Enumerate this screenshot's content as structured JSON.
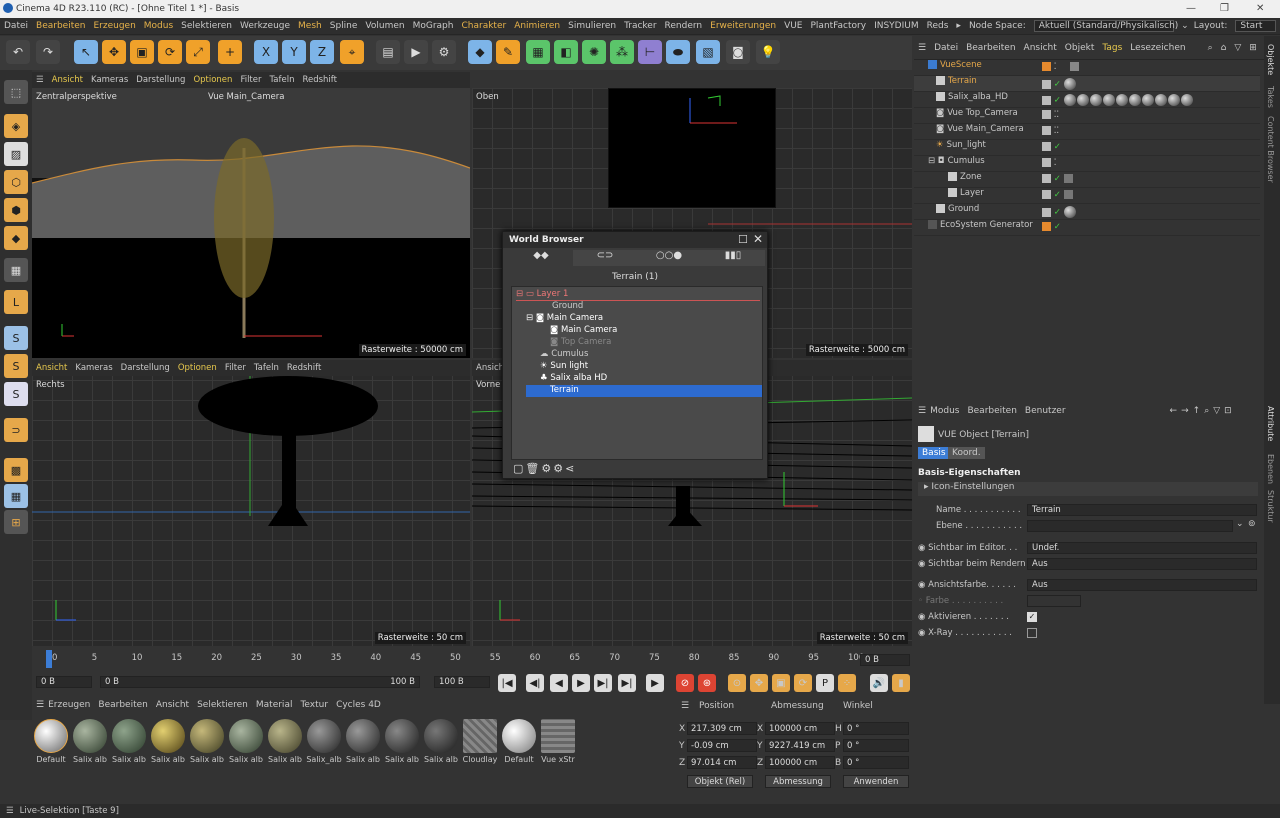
{
  "title": "Cinema 4D R23.110 (RC) - [Ohne Titel 1 *] - Basis",
  "menu": [
    "Datei",
    "Bearbeiten",
    "Erzeugen",
    "Modus",
    "Selektieren",
    "Werkzeuge",
    "Mesh",
    "Spline",
    "Volumen",
    "MoGraph",
    "Charakter",
    "Animieren",
    "Simulieren",
    "Tracker",
    "Rendern",
    "Erweiterungen",
    "VUE",
    "PlantFactory",
    "INSYDIUM",
    "Reds"
  ],
  "nodespace": {
    "label": "Node Space:",
    "value": "Aktuell (Standard/Physikalisch)"
  },
  "layout": {
    "label": "Layout:",
    "value": "Start"
  },
  "vp_menu": [
    "Ansicht",
    "Kameras",
    "Darstellung",
    "Optionen",
    "Filter",
    "Tafeln",
    "Redshift"
  ],
  "vp1": {
    "name": "Zentralperspektive",
    "camera": "Vue Main_Camera",
    "raster": "Rasterweite : 50000 cm"
  },
  "vp2": {
    "name": "Oben",
    "raster": "Rasterweite : 5000 cm"
  },
  "vp3": {
    "name": "Rechts",
    "raster": "Rasterweite : 50 cm"
  },
  "vp4": {
    "name": "Vorne",
    "raster": "Rasterweite : 50 cm",
    "menu_first": "Ansich"
  },
  "world_browser": {
    "title": "World Browser",
    "header": "Terrain (1)",
    "items": [
      "Layer 1",
      "Ground",
      "Main Camera",
      "Main Camera",
      "Top Camera",
      "Cumulus",
      "Sun light",
      "Salix alba HD",
      "Terrain"
    ]
  },
  "obj_menu": [
    "Datei",
    "Bearbeiten",
    "Ansicht",
    "Objekt",
    "Tags",
    "Lesezeichen"
  ],
  "objects": [
    "VueScene",
    "Terrain",
    "Salix_alba_HD",
    "Vue Top_Camera",
    "Vue Main_Camera",
    "Sun_light",
    "Cumulus",
    "Zone",
    "Layer",
    "Ground",
    "EcoSystem Generator"
  ],
  "attr": {
    "menu": [
      "Modus",
      "Bearbeiten",
      "Benutzer"
    ],
    "object": "VUE Object [Terrain]",
    "tabs": [
      "Basis",
      "Koord."
    ],
    "section": "Basis-Eigenschaften",
    "sub": "Icon-Einstellungen",
    "name_label": "Name . . . . . . . . . . .",
    "name_value": "Terrain",
    "ebene_label": "Ebene . . . . . . . . . . .",
    "vis_editor_label": "Sichtbar im Editor. . .",
    "vis_editor": "Undef.",
    "vis_render_label": "Sichtbar beim Rendern",
    "vis_render": "Aus",
    "ansicht_label": "Ansichtsfarbe. . . . . .",
    "ansicht": "Aus",
    "farbe_label": "Farbe . . . . . . . . . .",
    "aktiv_label": "Aktivieren . . . . . . .",
    "xray_label": "X-Ray . . . . . . . . . . ."
  },
  "right_tabs": [
    "Objekte",
    "Takes",
    "Content Browser",
    "Attribute",
    "Ebenen",
    "Struktur"
  ],
  "timeline": {
    "ticks": [
      "0",
      "5",
      "10",
      "15",
      "20",
      "25",
      "30",
      "35",
      "40",
      "45",
      "50",
      "55",
      "60",
      "65",
      "70",
      "75",
      "80",
      "85",
      "90",
      "95",
      "100"
    ],
    "frame": "0 B",
    "start": "0 B",
    "cur": "0 B",
    "end": "100 B",
    "end2": "100 B"
  },
  "mat_menu": [
    "Erzeugen",
    "Bearbeiten",
    "Ansicht",
    "Selektieren",
    "Material",
    "Textur",
    "Cycles 4D"
  ],
  "materials": [
    "Default",
    "Salix alb",
    "Salix alb",
    "Salix alb",
    "Salix alb",
    "Salix alb",
    "Salix alb",
    "Salix_alb",
    "Salix alb",
    "Salix alb",
    "Salix alb",
    "Cloudlay",
    "Default",
    "Vue xStr"
  ],
  "coord": {
    "h1": "Position",
    "h2": "Abmessung",
    "h3": "Winkel",
    "x": "X",
    "y": "Y",
    "z": "Z",
    "px": "217.309 cm",
    "py": "-0.09 cm",
    "pz": "97.014 cm",
    "sx": "100000 cm",
    "sy": "9227.419 cm",
    "sz": "100000 cm",
    "h": "H",
    "p": "P",
    "b": "B",
    "rh": "0 °",
    "rp": "0 °",
    "rb": "0 °",
    "mode1": "Objekt (Rel)",
    "mode2": "Abmessung",
    "apply": "Anwenden"
  },
  "status": "Live-Selektion [Taste 9]"
}
